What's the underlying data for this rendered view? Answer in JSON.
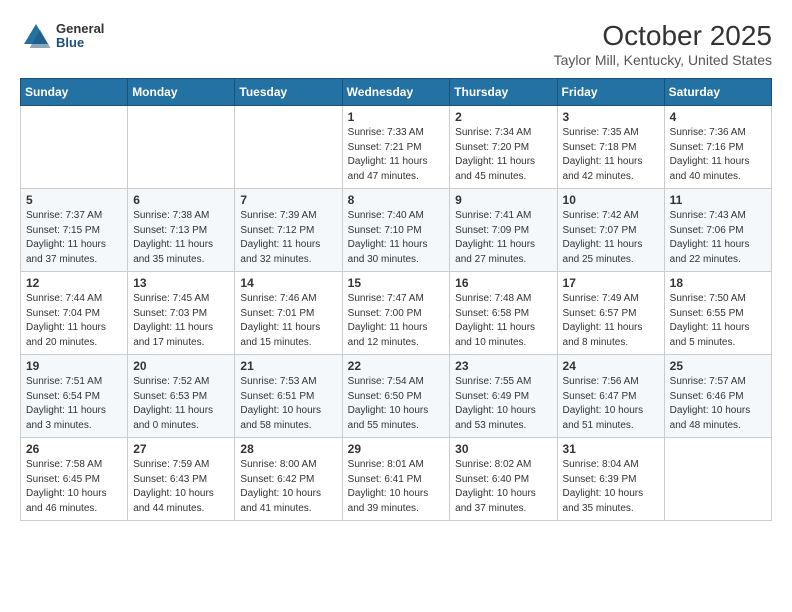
{
  "header": {
    "logo_general": "General",
    "logo_blue": "Blue",
    "title": "October 2025",
    "subtitle": "Taylor Mill, Kentucky, United States"
  },
  "calendar": {
    "days_of_week": [
      "Sunday",
      "Monday",
      "Tuesday",
      "Wednesday",
      "Thursday",
      "Friday",
      "Saturday"
    ],
    "weeks": [
      [
        {
          "day": "",
          "info": ""
        },
        {
          "day": "",
          "info": ""
        },
        {
          "day": "",
          "info": ""
        },
        {
          "day": "1",
          "info": "Sunrise: 7:33 AM\nSunset: 7:21 PM\nDaylight: 11 hours\nand 47 minutes."
        },
        {
          "day": "2",
          "info": "Sunrise: 7:34 AM\nSunset: 7:20 PM\nDaylight: 11 hours\nand 45 minutes."
        },
        {
          "day": "3",
          "info": "Sunrise: 7:35 AM\nSunset: 7:18 PM\nDaylight: 11 hours\nand 42 minutes."
        },
        {
          "day": "4",
          "info": "Sunrise: 7:36 AM\nSunset: 7:16 PM\nDaylight: 11 hours\nand 40 minutes."
        }
      ],
      [
        {
          "day": "5",
          "info": "Sunrise: 7:37 AM\nSunset: 7:15 PM\nDaylight: 11 hours\nand 37 minutes."
        },
        {
          "day": "6",
          "info": "Sunrise: 7:38 AM\nSunset: 7:13 PM\nDaylight: 11 hours\nand 35 minutes."
        },
        {
          "day": "7",
          "info": "Sunrise: 7:39 AM\nSunset: 7:12 PM\nDaylight: 11 hours\nand 32 minutes."
        },
        {
          "day": "8",
          "info": "Sunrise: 7:40 AM\nSunset: 7:10 PM\nDaylight: 11 hours\nand 30 minutes."
        },
        {
          "day": "9",
          "info": "Sunrise: 7:41 AM\nSunset: 7:09 PM\nDaylight: 11 hours\nand 27 minutes."
        },
        {
          "day": "10",
          "info": "Sunrise: 7:42 AM\nSunset: 7:07 PM\nDaylight: 11 hours\nand 25 minutes."
        },
        {
          "day": "11",
          "info": "Sunrise: 7:43 AM\nSunset: 7:06 PM\nDaylight: 11 hours\nand 22 minutes."
        }
      ],
      [
        {
          "day": "12",
          "info": "Sunrise: 7:44 AM\nSunset: 7:04 PM\nDaylight: 11 hours\nand 20 minutes."
        },
        {
          "day": "13",
          "info": "Sunrise: 7:45 AM\nSunset: 7:03 PM\nDaylight: 11 hours\nand 17 minutes."
        },
        {
          "day": "14",
          "info": "Sunrise: 7:46 AM\nSunset: 7:01 PM\nDaylight: 11 hours\nand 15 minutes."
        },
        {
          "day": "15",
          "info": "Sunrise: 7:47 AM\nSunset: 7:00 PM\nDaylight: 11 hours\nand 12 minutes."
        },
        {
          "day": "16",
          "info": "Sunrise: 7:48 AM\nSunset: 6:58 PM\nDaylight: 11 hours\nand 10 minutes."
        },
        {
          "day": "17",
          "info": "Sunrise: 7:49 AM\nSunset: 6:57 PM\nDaylight: 11 hours\nand 8 minutes."
        },
        {
          "day": "18",
          "info": "Sunrise: 7:50 AM\nSunset: 6:55 PM\nDaylight: 11 hours\nand 5 minutes."
        }
      ],
      [
        {
          "day": "19",
          "info": "Sunrise: 7:51 AM\nSunset: 6:54 PM\nDaylight: 11 hours\nand 3 minutes."
        },
        {
          "day": "20",
          "info": "Sunrise: 7:52 AM\nSunset: 6:53 PM\nDaylight: 11 hours\nand 0 minutes."
        },
        {
          "day": "21",
          "info": "Sunrise: 7:53 AM\nSunset: 6:51 PM\nDaylight: 10 hours\nand 58 minutes."
        },
        {
          "day": "22",
          "info": "Sunrise: 7:54 AM\nSunset: 6:50 PM\nDaylight: 10 hours\nand 55 minutes."
        },
        {
          "day": "23",
          "info": "Sunrise: 7:55 AM\nSunset: 6:49 PM\nDaylight: 10 hours\nand 53 minutes."
        },
        {
          "day": "24",
          "info": "Sunrise: 7:56 AM\nSunset: 6:47 PM\nDaylight: 10 hours\nand 51 minutes."
        },
        {
          "day": "25",
          "info": "Sunrise: 7:57 AM\nSunset: 6:46 PM\nDaylight: 10 hours\nand 48 minutes."
        }
      ],
      [
        {
          "day": "26",
          "info": "Sunrise: 7:58 AM\nSunset: 6:45 PM\nDaylight: 10 hours\nand 46 minutes."
        },
        {
          "day": "27",
          "info": "Sunrise: 7:59 AM\nSunset: 6:43 PM\nDaylight: 10 hours\nand 44 minutes."
        },
        {
          "day": "28",
          "info": "Sunrise: 8:00 AM\nSunset: 6:42 PM\nDaylight: 10 hours\nand 41 minutes."
        },
        {
          "day": "29",
          "info": "Sunrise: 8:01 AM\nSunset: 6:41 PM\nDaylight: 10 hours\nand 39 minutes."
        },
        {
          "day": "30",
          "info": "Sunrise: 8:02 AM\nSunset: 6:40 PM\nDaylight: 10 hours\nand 37 minutes."
        },
        {
          "day": "31",
          "info": "Sunrise: 8:04 AM\nSunset: 6:39 PM\nDaylight: 10 hours\nand 35 minutes."
        },
        {
          "day": "",
          "info": ""
        }
      ]
    ]
  }
}
